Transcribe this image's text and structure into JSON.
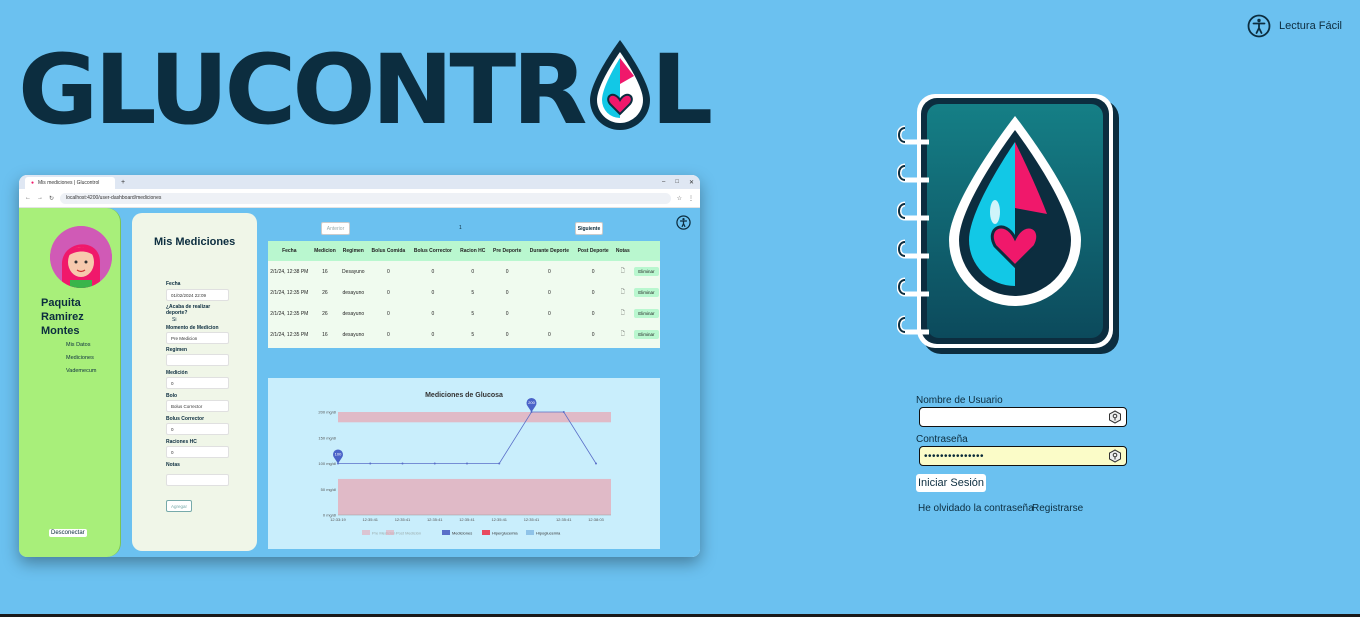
{
  "accessibility": {
    "label": "Lectura Fácil",
    "icon": "accessibility-icon"
  },
  "logo": {
    "text": "GLUCONTR",
    "text_end": "L",
    "icon": "blood-drop-heart-icon"
  },
  "preview": {
    "tab_title": "Mis mediciones | Glucontrol",
    "url": "localhost:4200/user-dashboard/mediciones",
    "user_name": "Paquita Ramirez Montes",
    "nav": [
      "Mis Datos",
      "Mediciones",
      "Vademecum"
    ],
    "logout": "Desconectar",
    "form": {
      "title": "Mis Mediciones",
      "fecha_label": "Fecha",
      "fecha_value": "01/02/2024 22:09",
      "deporte_label": "¿Acaba de realizar deporte?",
      "deporte_value": "Si",
      "momento_label": "Momento de Medicion",
      "momento_value": "Pre Medicion",
      "regimen_label": "Regimen",
      "regimen_value": "",
      "medicion_label": "Medición",
      "medicion_value": "0",
      "bolo_label": "Bolo",
      "bolo_value": "Bolus Corrector",
      "bolus_corrector_label": "Bolus Corrector",
      "bolus_corrector_value": "0",
      "raciones_label": "Raciones HC",
      "raciones_value": "0",
      "notas_label": "Notas",
      "submit": "Agregar"
    },
    "pager": {
      "prev": "Anterior",
      "page": "1",
      "next": "Siguiente"
    },
    "table": {
      "headers": [
        "Fecha",
        "Medicion",
        "Regimen",
        "Bolus Comida",
        "Bolus Corrector",
        "Racion HC",
        "Pre Deporte",
        "Durante Deporte",
        "Post Deporte",
        "Notas",
        ""
      ],
      "rows": [
        [
          "2/1/24, 12:38 PM",
          "16",
          "Desayuno",
          "0",
          "0",
          "0",
          "0",
          "0",
          "0"
        ],
        [
          "2/1/24, 12:35 PM",
          "26",
          "desayuno",
          "0",
          "0",
          "5",
          "0",
          "0",
          "0"
        ],
        [
          "2/1/24, 12:35 PM",
          "26",
          "desayuno",
          "0",
          "0",
          "5",
          "0",
          "0",
          "0"
        ],
        [
          "2/1/24, 12:35 PM",
          "16",
          "desayuno",
          "0",
          "0",
          "5",
          "0",
          "0",
          "0"
        ]
      ],
      "delete_label": "Eliminar"
    }
  },
  "chart_data": {
    "type": "line",
    "title": "Mediciones de Glucosa",
    "x": [
      "12:33:19",
      "12:35:41",
      "12:35:41",
      "12:35:41",
      "12:35:41",
      "12:35:41",
      "12:35:41",
      "12:35:41",
      "12:38:03"
    ],
    "series": [
      {
        "name": "Mediciones",
        "values": [
          100,
          100,
          100,
          100,
          100,
          100,
          200,
          200,
          100
        ]
      }
    ],
    "yticks": [
      "0 mg/dl",
      "50 mg/dl",
      "100 mg/dl",
      "150 mg/dl",
      "200 mg/dl"
    ],
    "ylim": [
      0,
      200
    ],
    "bands": [
      {
        "name": "Hiperglucemia",
        "from": 180,
        "to": 200,
        "color": "#e7a8b6"
      },
      {
        "name": "Hipoglucemia",
        "from": 0,
        "to": 70,
        "color": "#e7a8b6"
      }
    ],
    "point_labels": [
      {
        "index": 0,
        "text": "100"
      },
      {
        "index": 6,
        "text": "200"
      }
    ],
    "legend": [
      "Pre Medición",
      "Post Medición",
      "Mediciones",
      "Hiperglucemia",
      "Hipoglucemia"
    ],
    "legend_position": "bottom"
  },
  "login": {
    "username_label": "Nombre de Usuario",
    "username_value": "",
    "password_label": "Contraseña",
    "password_value": "•••••••••••••••",
    "submit": "Iniciar Sesión",
    "forgot": "He olvidado la contraseña",
    "register": "Registrarse"
  },
  "colors": {
    "background": "#6bc1f0",
    "navy": "#0c2d3f",
    "pink": "#f0186b",
    "cyan": "#12c8e6",
    "sidebar": "#a8ef7a"
  }
}
